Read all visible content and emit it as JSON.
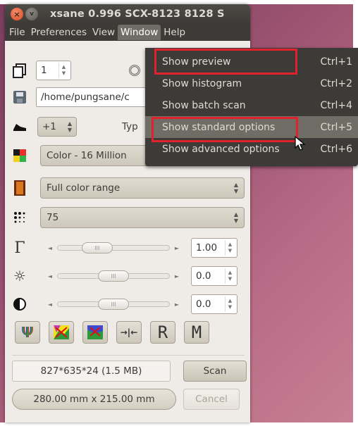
{
  "window": {
    "title": "xsane 0.996 SCX-8123 8128 S",
    "close_glyph": "×",
    "minimize_glyph": "v"
  },
  "menubar": {
    "items": [
      {
        "label": "File"
      },
      {
        "label": "Preferences"
      },
      {
        "label": "View"
      },
      {
        "label": "Window"
      },
      {
        "label": "Help"
      }
    ]
  },
  "window_menu": {
    "items": [
      {
        "label": "Show preview",
        "accel": "Ctrl+1"
      },
      {
        "label": "Show histogram",
        "accel": "Ctrl+2"
      },
      {
        "label": "Show batch scan",
        "accel": "Ctrl+4"
      },
      {
        "label": "Show standard options",
        "accel": "Ctrl+5"
      },
      {
        "label": "Show advanced options",
        "accel": "Ctrl+6"
      }
    ]
  },
  "controls": {
    "copies_value": "1",
    "filename_value": "/home/pungsane/c",
    "type_partial_label": "Typ",
    "step_value": "+1",
    "color_mode": "Color - 16 Million",
    "color_range": "Full color range",
    "resolution": "75",
    "gamma_value": "1.00",
    "brightness_value": "0.0",
    "contrast_value": "0.0",
    "gamma_slider": 0.3,
    "brightness_slider": 0.5,
    "contrast_slider": 0.5,
    "knob_grip": "III"
  },
  "toolbar": {
    "buttons": [
      {
        "name": "channel-icon",
        "glyph": "Ψ"
      },
      {
        "name": "auto-enhance-icon",
        "glyph": ""
      },
      {
        "name": "default-enhance-icon",
        "glyph": ""
      },
      {
        "name": "restore-enhance-icon",
        "glyph": "→|←"
      },
      {
        "name": "store-enhance-icon",
        "glyph": "R"
      },
      {
        "name": "medium-icon",
        "glyph": "M"
      }
    ]
  },
  "status": {
    "image_info": "827*635*24 (1.5 MB)",
    "scan_button": "Scan",
    "dimensions": "280.00 mm x 215.00 mm",
    "cancel_button": "Cancel"
  },
  "colors": {
    "highlight_box": "#e0222d",
    "menubar_bg": "#3c3b37",
    "window_bg": "#efebe7"
  }
}
